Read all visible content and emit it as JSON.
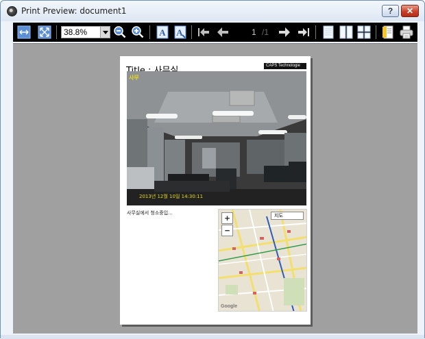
{
  "window": {
    "title": "Print Preview: document1",
    "help_label": "?",
    "close_label": "✕"
  },
  "toolbar": {
    "zoom_value": "38.8%",
    "page_current": "1",
    "page_total": "/1",
    "icons": [
      "fit-width-icon",
      "fit-page-icon",
      "zoom-out-icon",
      "zoom-in-icon",
      "font-icon",
      "font-color-icon",
      "first-page-icon",
      "previous-page-icon",
      "next-page-icon",
      "last-page-icon",
      "single-page-icon",
      "two-page-icon",
      "multi-page-icon",
      "page-setup-icon",
      "print-icon"
    ],
    "font_label": "A",
    "font_color_label": "A"
  },
  "page": {
    "title": "Title : 사무실",
    "logo": "CAPS Technologie",
    "photo_label": "사무",
    "photo_overlay": "2013년 12월 10일 14:30:11",
    "caption": "사무실에서 청소중입...",
    "map": {
      "zoom_in": "+",
      "zoom_out": "−",
      "map_type": "지도",
      "attribution": "Google"
    }
  },
  "colors": {
    "toolbar_bg": "#000000",
    "canvas_bg": "#a0a0a0",
    "icon_blue": "#5b8fd6",
    "close_red": "#c9402a"
  }
}
